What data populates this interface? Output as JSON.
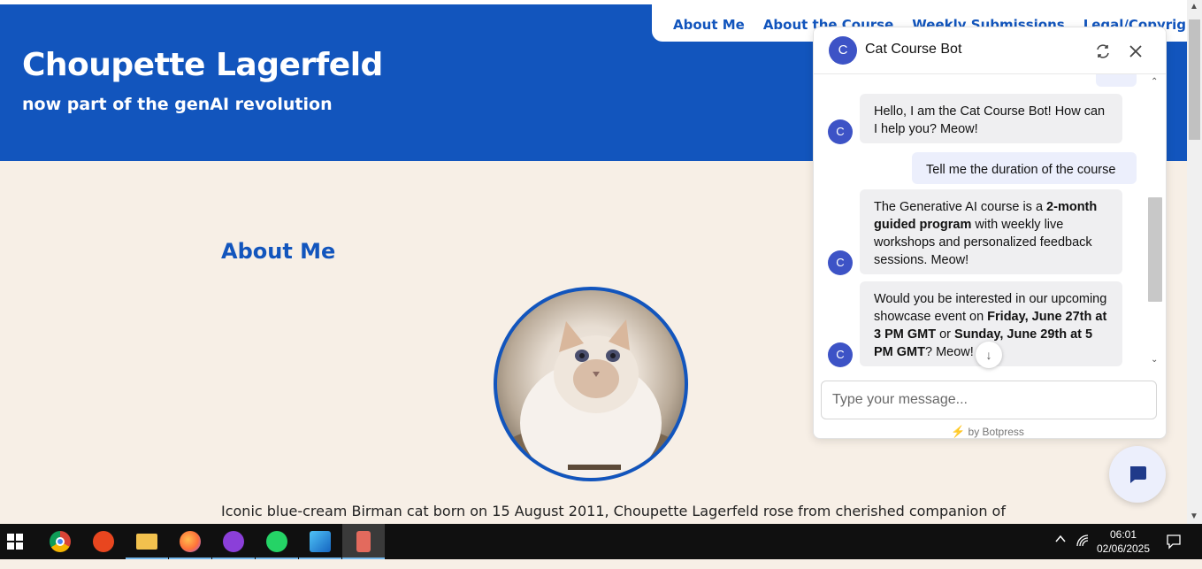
{
  "site": {
    "title": "Choupette Lagerfeld",
    "subtitle": "now part of the genAI revolution"
  },
  "nav": {
    "items": [
      "About Me",
      "About the Course",
      "Weekly Submissions",
      "Legal/Copyright Notice"
    ]
  },
  "main": {
    "section_heading": "About Me",
    "bio": "Iconic blue-cream Birman cat born on 15 August 2011, Choupette Lagerfeld rose from cherished companion of"
  },
  "chat": {
    "avatar_letter": "C",
    "title": "Cat Course Bot",
    "messages": [
      {
        "from": "bot",
        "text": "Hello, I am the Cat Course Bot! How can I help you? Meow!"
      },
      {
        "from": "user",
        "text": "Tell me the duration of the course"
      },
      {
        "from": "bot",
        "parts": [
          "The Generative AI course is a ",
          "2-month guided program",
          " with weekly live workshops and personalized feedback sessions. Meow!"
        ]
      },
      {
        "from": "bot",
        "parts": [
          "Would you be interested in our upcoming showcase event on ",
          "Friday, June 27th at 3 PM GMT",
          " or ",
          "Sunday, June 29th at 5 PM GMT",
          "? Meow!"
        ]
      }
    ],
    "input_placeholder": "Type your message...",
    "powered_by": "by Botpress"
  },
  "taskbar": {
    "apps": [
      "chrome",
      "app-red",
      "file-explorer",
      "firefox",
      "app-purple",
      "whatsapp",
      "photos",
      "app-active"
    ],
    "time": "06:01",
    "date": "02/06/2025"
  },
  "colors": {
    "brand_blue": "#1255bd",
    "page_bg": "#f7efe6",
    "bot_avatar": "#3d53c6",
    "user_bubble": "#eceffc",
    "bot_bubble": "#efeff1"
  }
}
